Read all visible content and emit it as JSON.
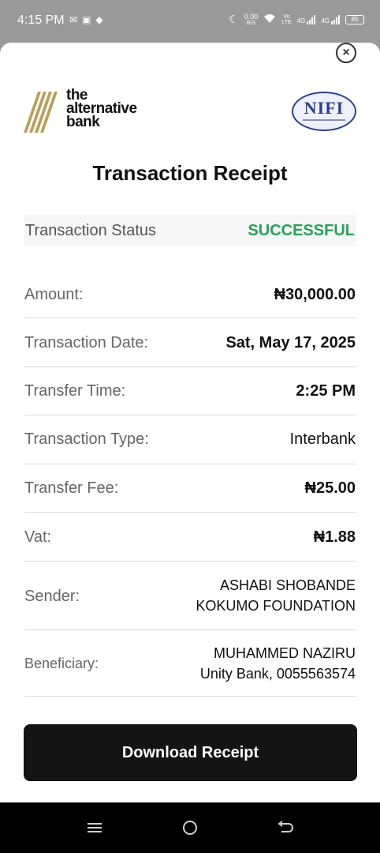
{
  "status_bar": {
    "time": "4:15 PM",
    "icons": [
      "mail-icon",
      "notification-icon",
      "android-icon",
      "moon-icon",
      "data-speed-icon",
      "wifi-icon",
      "volte-icon",
      "signal-4g-icon",
      "signal-4g-icon",
      "battery-icon"
    ],
    "data_speed_value": "0.00",
    "data_speed_unit": "B/S",
    "volte_top": "Vo",
    "volte_bottom": "LTE",
    "net_1": "4G",
    "net_2": "4G",
    "battery": "85"
  },
  "receipt": {
    "close_symbol": "×",
    "logo": {
      "line1": "the",
      "line2": "alternative",
      "line3": "bank"
    },
    "partner_logo": "NIFI",
    "title": "Transaction Receipt",
    "status": {
      "label": "Transaction Status",
      "value": "SUCCESSFUL",
      "color": "#27a25a"
    },
    "rows": [
      {
        "label": "Amount:",
        "value": "₦30,000.00"
      },
      {
        "label": "Transaction Date:",
        "value": "Sat, May 17, 2025"
      },
      {
        "label": "Transfer Time:",
        "value": "2:25 PM"
      },
      {
        "label": "Transaction Type:",
        "value": "Interbank"
      },
      {
        "label": "Transfer Fee:",
        "value": "₦25.00"
      },
      {
        "label": "Vat:",
        "value": "₦1.88"
      }
    ],
    "sender": {
      "label": "Sender:",
      "line1": "ASHABI SHOBANDE",
      "line2": "KOKUMO FOUNDATION"
    },
    "beneficiary": {
      "label": "Beneficiary:",
      "line1": "MUHAMMED NAZIRU",
      "line2": "Unity Bank, 0055563574"
    },
    "download_label": "Download Receipt"
  },
  "nav_bar": {
    "icons": [
      "menu-icon",
      "home-icon",
      "back-icon"
    ]
  },
  "colors": {
    "accent": "#27a25a",
    "button_bg": "#141414",
    "logo_gold": "#b8a15a",
    "nifi_blue": "#2f3f8f"
  }
}
